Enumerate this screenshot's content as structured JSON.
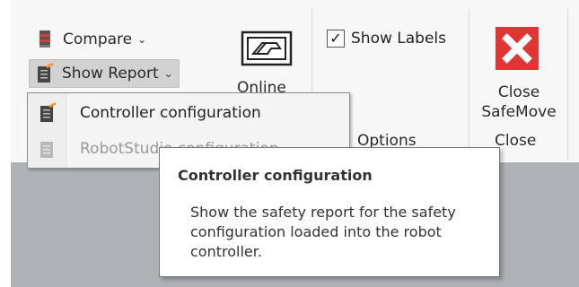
{
  "ribbon": {
    "compare_label": "Compare",
    "show_report_label": "Show Report",
    "online_label": "Online",
    "show_labels": {
      "label": "Show Labels",
      "checked": true
    },
    "options_group_label": "Options",
    "close_safemove_label": "Close SafeMove",
    "close_group_label": "Close"
  },
  "dropdown": {
    "items": [
      {
        "label": "Controller configuration",
        "enabled": true
      },
      {
        "label": "RobotStudio configuration",
        "enabled": false
      }
    ]
  },
  "tooltip": {
    "title": "Controller configuration",
    "body": "Show the safety report for the safety configuration loaded into the robot controller."
  },
  "colors": {
    "close_icon_red": "#e03535",
    "report_icon_orange": "#f29a2e",
    "ribbon_bg": "#f7f7f7",
    "backdrop_gray": "#aeb2b7"
  },
  "icons": {
    "compare": "compare-icon",
    "show_report": "report-icon",
    "online": "online-icon",
    "close": "close-x-icon"
  }
}
